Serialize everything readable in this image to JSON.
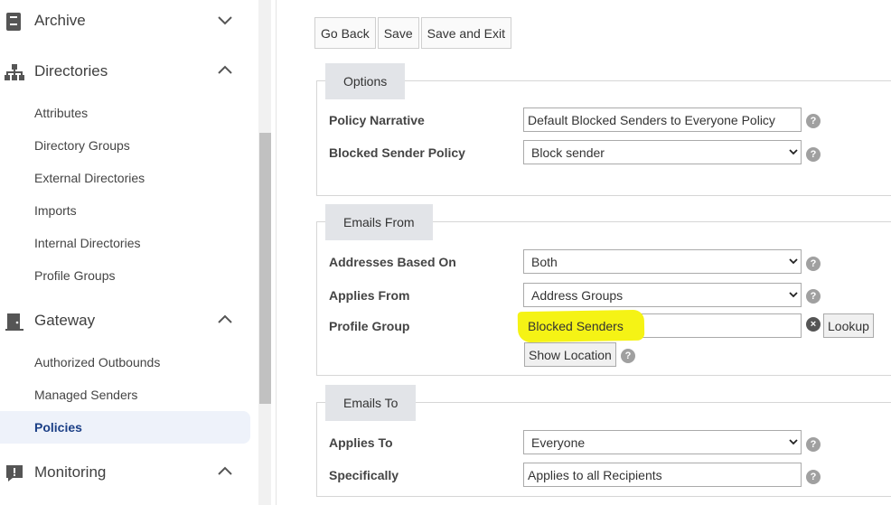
{
  "sidebar": {
    "archive": {
      "label": "Archive",
      "icon": "archive-icon",
      "expanded": false
    },
    "directories": {
      "label": "Directories",
      "icon": "sitemap-icon",
      "expanded": true,
      "items": [
        "Attributes",
        "Directory Groups",
        "External Directories",
        "Imports",
        "Internal Directories",
        "Profile Groups"
      ]
    },
    "gateway": {
      "label": "Gateway",
      "icon": "door-icon",
      "expanded": true,
      "items": [
        "Authorized Outbounds",
        "Managed Senders",
        "Policies"
      ],
      "active_item": "Policies"
    },
    "monitoring": {
      "label": "Monitoring",
      "icon": "alert-icon",
      "expanded": true
    }
  },
  "toolbar": {
    "go_back": "Go Back",
    "save": "Save",
    "save_exit": "Save and Exit"
  },
  "options": {
    "tab": "Options",
    "policy_narrative": {
      "label": "Policy Narrative",
      "value": "Default Blocked Senders to Everyone Policy"
    },
    "blocked_sender_policy": {
      "label": "Blocked Sender Policy",
      "value": "Block sender"
    }
  },
  "emails_from": {
    "tab": "Emails From",
    "addresses_based_on": {
      "label": "Addresses Based On",
      "value": "Both"
    },
    "applies_from": {
      "label": "Applies From",
      "value": "Address Groups"
    },
    "profile_group": {
      "label": "Profile Group",
      "value": "Blocked Senders",
      "lookup": "Lookup"
    },
    "show_location": "Show Location"
  },
  "emails_to": {
    "tab": "Emails To",
    "applies_to": {
      "label": "Applies To",
      "value": "Everyone"
    },
    "specifically": {
      "label": "Specifically",
      "value": "Applies to all Recipients"
    }
  },
  "help_glyph": "?",
  "clear_glyph": "×",
  "colors": {
    "active_bg": "#eef2fa",
    "active_text": "#1b3f86",
    "highlight": "#f5f315"
  }
}
